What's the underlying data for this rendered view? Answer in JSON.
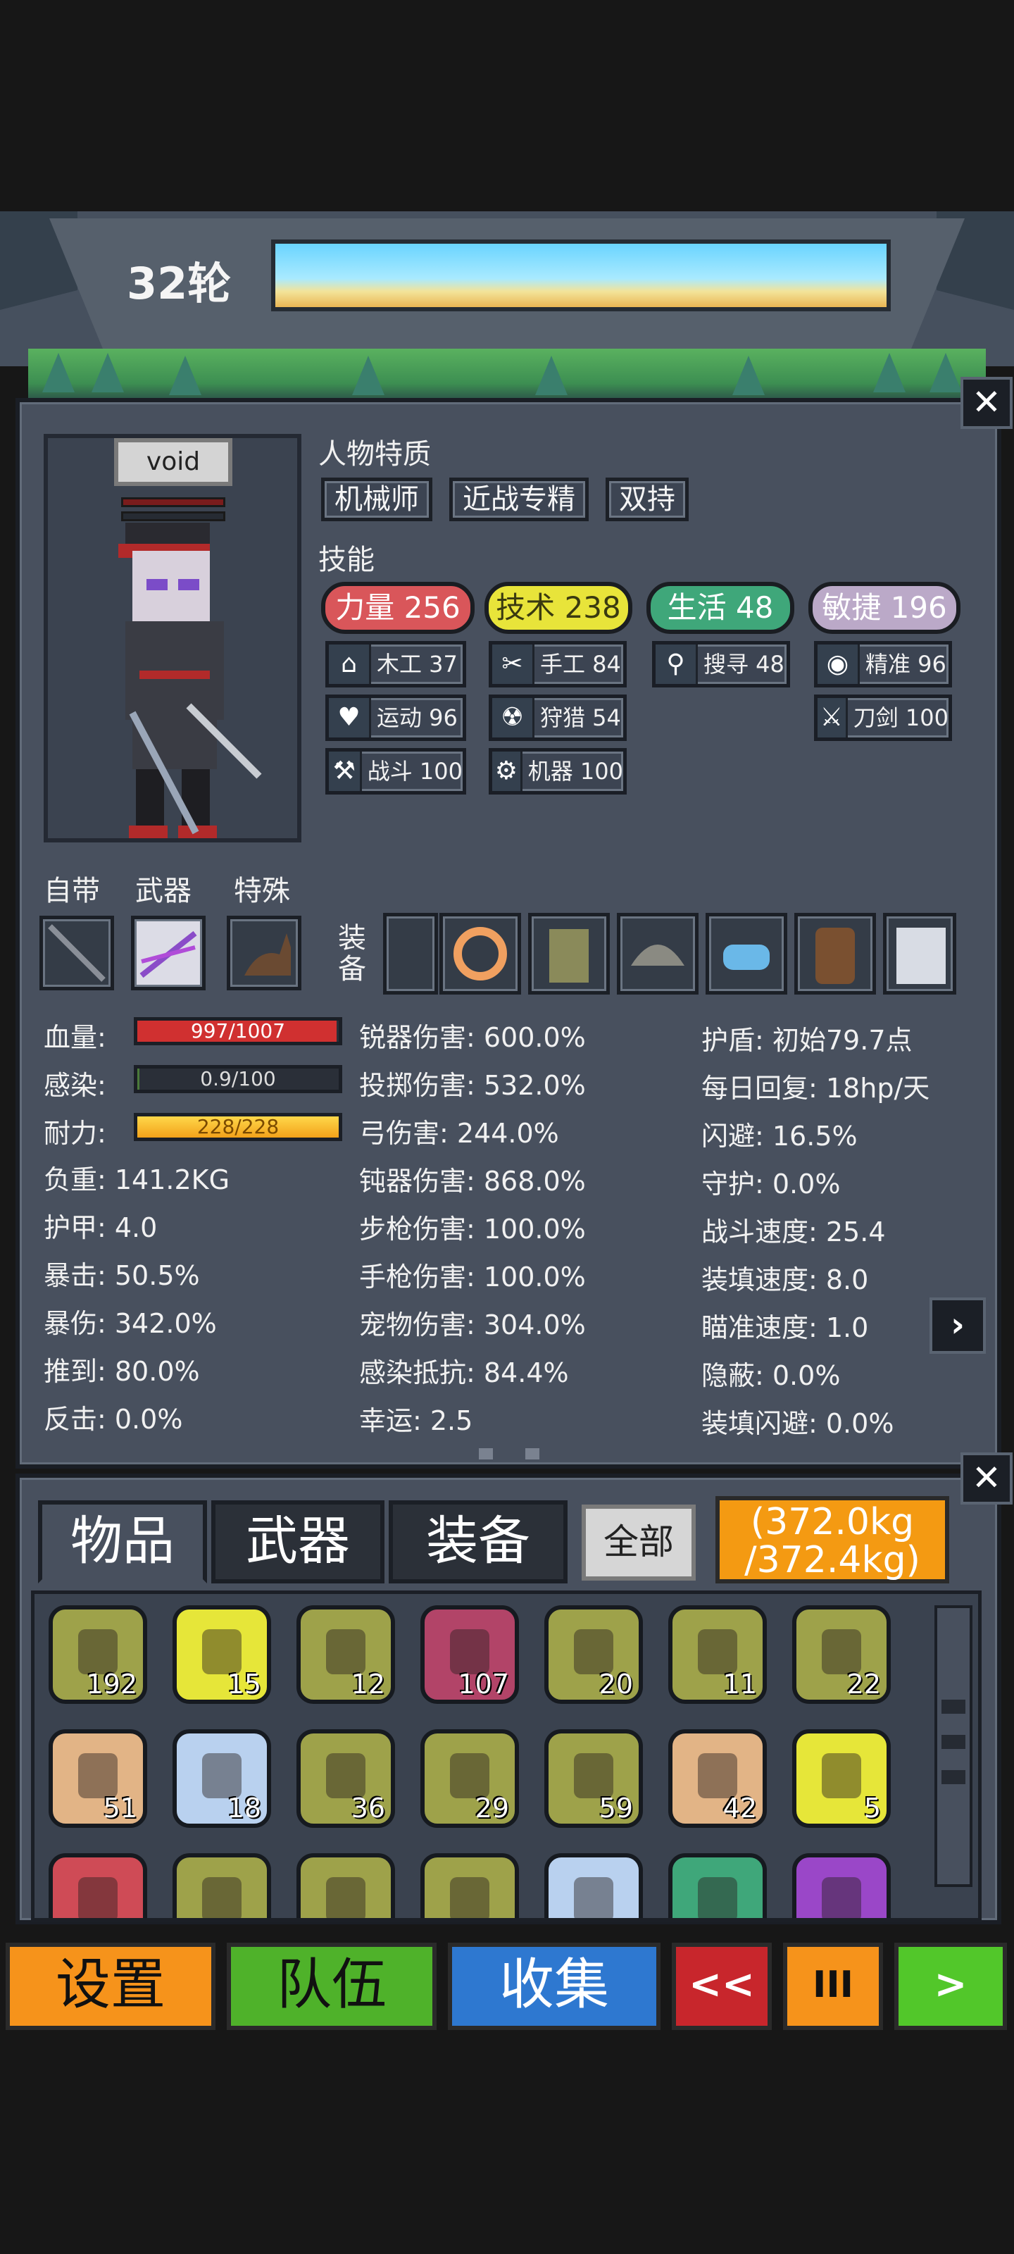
{
  "header": {
    "round_label": "32轮"
  },
  "character": {
    "name": "void",
    "traits_title": "人物特质",
    "traits": [
      "机械师",
      "近战专精",
      "双持"
    ],
    "skills_title": "技能",
    "attributes": [
      {
        "label": "力量 256",
        "color": "#d9565a"
      },
      {
        "label": "技术 238",
        "color": "#e8e43a"
      },
      {
        "label": "生活 48",
        "color": "#3fa77a"
      },
      {
        "label": "敏捷 196",
        "color": "#bba9c8"
      }
    ],
    "skills": [
      {
        "label": "木工 37",
        "icon": "house-icon"
      },
      {
        "label": "手工 84",
        "icon": "scissors-icon"
      },
      {
        "label": "搜寻 48",
        "icon": "magnifier-icon"
      },
      {
        "label": "精准 96",
        "icon": "eye-icon"
      },
      {
        "label": "运动 96",
        "icon": "heart-icon"
      },
      {
        "label": "狩猎 54",
        "icon": "radiation-icon"
      },
      {
        "label": "刀剑 100",
        "icon": "sword-icon"
      },
      {
        "label": "战斗 100",
        "icon": "wrench-icon"
      },
      {
        "label": "机器 100",
        "icon": "gear-icon"
      }
    ]
  },
  "equipment": {
    "innate_label": "自带",
    "weapon_label": "武器",
    "special_label": "特殊",
    "gear_label_1": "装",
    "gear_label_2": "备"
  },
  "stats": {
    "hp_label": "血量:",
    "hp_value": "997/1007",
    "hp_fraction": 0.99,
    "infection_label": "感染:",
    "infection_value": "0.9/100",
    "infection_fraction": 0.009,
    "stamina_label": "耐力:",
    "stamina_value": "228/228",
    "stamina_fraction": 1.0,
    "col1": [
      "负重: 141.2KG",
      "护甲: 4.0",
      "暴击: 50.5%",
      "暴伤: 342.0%",
      "推到: 80.0%",
      "反击: 0.0%"
    ],
    "col2": [
      "锐器伤害: 600.0%",
      "投掷伤害: 532.0%",
      "弓伤害: 244.0%",
      "钝器伤害: 868.0%",
      "步枪伤害: 100.0%",
      "手枪伤害: 100.0%",
      "宠物伤害: 304.0%",
      "感染抵抗: 84.4%",
      "幸运: 2.5"
    ],
    "col3": [
      "护盾: 初始79.7点",
      "每日回复: 18hp/天",
      "闪避: 16.5%",
      "守护: 0.0%",
      "战斗速度: 25.4",
      "装填速度: 8.0",
      "瞄准速度: 1.0",
      "隐蔽: 0.0%",
      "装填闪避: 0.0%"
    ]
  },
  "inventory": {
    "tabs": [
      "物品",
      "武器",
      "装备"
    ],
    "filter_label": "全部",
    "weight_line1": "(372.0kg",
    "weight_line2": "/372.4kg)",
    "counts": [
      "192",
      "15",
      "12",
      "107",
      "20",
      "11",
      "22",
      "51",
      "18",
      "36",
      "29",
      "59",
      "42",
      "5",
      "",
      "",
      "",
      "",
      "",
      "",
      ""
    ],
    "item_colors": [
      "#9ea24a",
      "#e6e639",
      "#9ea24a",
      "#b24468",
      "#9ea24a",
      "#9ea24a",
      "#9ea24a",
      "#e2b486",
      "#b9d1ef",
      "#9ea24a",
      "#9ea24a",
      "#9ea24a",
      "#e2b486",
      "#e6e639",
      "#cf4b56",
      "#9ea24a",
      "#9ea24a",
      "#9ea24a",
      "#b9d1ef",
      "#3fa77a",
      "#9a47c8"
    ]
  },
  "bottom_bar": {
    "settings": "设置",
    "team": "队伍",
    "collect": "收集",
    "rewind": "<<",
    "pause": "III",
    "forward": ">"
  },
  "colors": {
    "orange": "#f6931b",
    "green": "#4fb22a",
    "blue": "#2e78d0",
    "red": "#c8262c",
    "bright_green": "#52c72a",
    "weight_bg": "#f49a12"
  }
}
